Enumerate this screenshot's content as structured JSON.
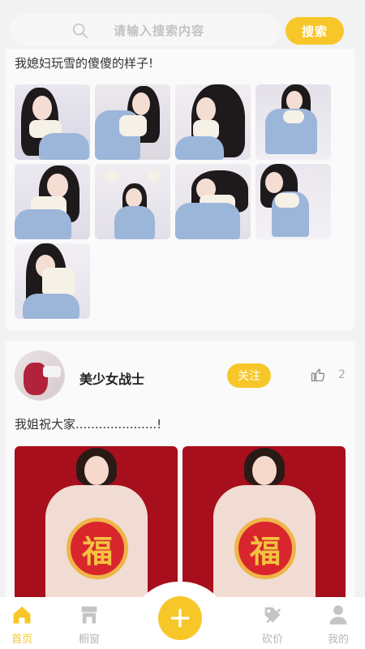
{
  "search": {
    "placeholder": "请输入搜索内容",
    "button_label": "搜索"
  },
  "posts": [
    {
      "text": "我媳妇玩雪的傻傻的样子!",
      "image_count": 9
    },
    {
      "author": "美少女战士",
      "follow_label": "关注",
      "like_count": "2",
      "text": "我姐祝大家.....................!",
      "image_count": 2,
      "image_glyph": "福"
    }
  ],
  "tabbar": {
    "items": [
      {
        "label": "首页",
        "icon": "home-icon",
        "active": true
      },
      {
        "label": "橱窗",
        "icon": "shop-icon",
        "active": false
      },
      {
        "label": "砍价",
        "icon": "bargain-icon",
        "active": false
      },
      {
        "label": "我的",
        "icon": "user-icon",
        "active": false
      }
    ],
    "add_icon": "plus-icon"
  },
  "colors": {
    "accent": "#f7c72a",
    "tab_inactive": "#b6b6b6",
    "card_bg": "#fafafa",
    "page_bg": "#f2f2f2"
  }
}
